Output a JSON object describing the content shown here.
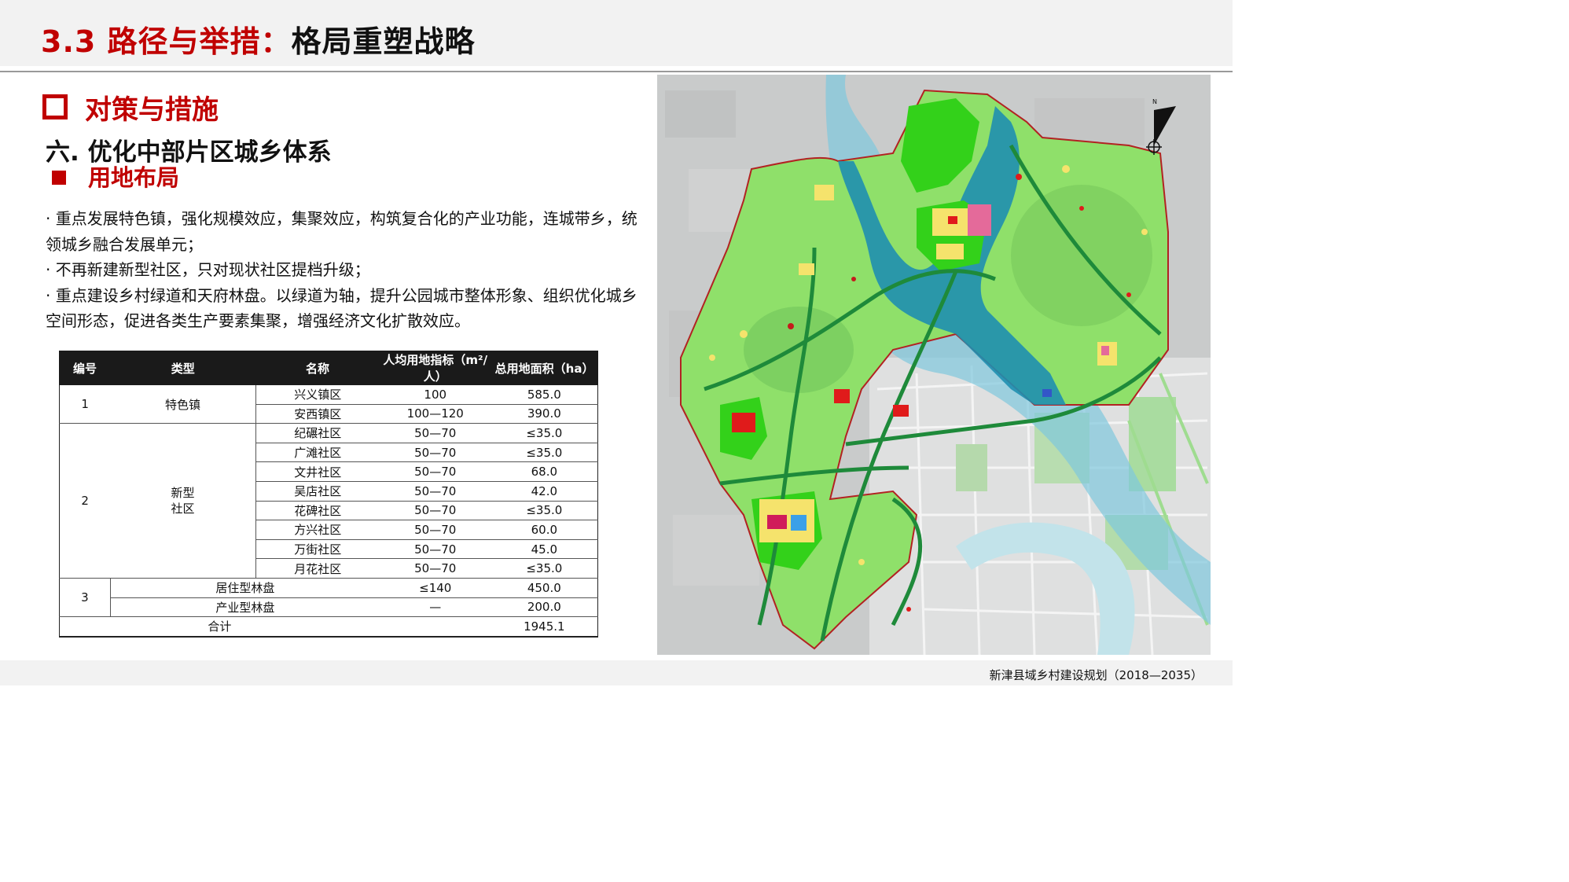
{
  "header": {
    "title_prefix": "3.3 路径与举措：",
    "title_main": "格局重塑战略"
  },
  "section": {
    "heading": "对策与措施",
    "subheading": "六. 优化中部片区城乡体系",
    "subsubheading": "用地布局"
  },
  "body": {
    "para1": "· 重点发展特色镇，强化规模效应，集聚效应，构筑复合化的产业功能，连城带乡，统领城乡融合发展单元；",
    "para2": "· 不再新建新型社区，只对现状社区提档升级；",
    "para3": "·  重点建设乡村绿道和天府林盘。以绿道为轴，提升公园城市整体形象、组织优化城乡空间形态，促进各类生产要素集聚，增强经济文化扩散效应。"
  },
  "table": {
    "headers": [
      "编号",
      "类型",
      "名称",
      "人均用地指标（m²/人）",
      "总用地面积（ha）"
    ],
    "groups": [
      {
        "no": "1",
        "type": "特色镇",
        "rows": [
          {
            "name": "兴义镇区",
            "index": "100",
            "area": "585.0"
          },
          {
            "name": "安西镇区",
            "index": "100—120",
            "area": "390.0"
          }
        ]
      },
      {
        "no": "2",
        "type_line1": "新型",
        "type_line2": "社区",
        "rows": [
          {
            "name": "纪碾社区",
            "index": "50—70",
            "area": "≤35.0"
          },
          {
            "name": "广滩社区",
            "index": "50—70",
            "area": "≤35.0"
          },
          {
            "name": "文井社区",
            "index": "50—70",
            "area": "68.0"
          },
          {
            "name": "吴店社区",
            "index": "50—70",
            "area": "42.0"
          },
          {
            "name": "花碑社区",
            "index": "50—70",
            "area": "≤35.0"
          },
          {
            "name": "方兴社区",
            "index": "50—70",
            "area": "60.0"
          },
          {
            "name": "万街社区",
            "index": "50—70",
            "area": "45.0"
          },
          {
            "name": "月花社区",
            "index": "50—70",
            "area": "≤35.0"
          }
        ]
      },
      {
        "no": "3",
        "rows": [
          {
            "name": "居住型林盘",
            "index": "≤140",
            "area": "450.0"
          },
          {
            "name": "产业型林盘",
            "index": "—",
            "area": "200.0"
          }
        ]
      }
    ],
    "total_label": "合计",
    "total_area": "1945.1"
  },
  "map": {
    "north_label": "N",
    "colors": {
      "green": "#8fe06a",
      "bright_green": "#33d11a",
      "river": "#1f8fb0",
      "road": "#1e8a3a",
      "boundary": "#b22222",
      "base": "#c9cbcb"
    }
  },
  "footer": {
    "text": "新津县域乡村建设规划（2018—2035）"
  }
}
